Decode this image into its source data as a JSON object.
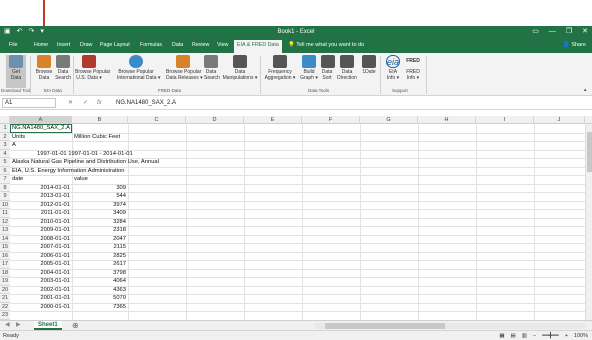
{
  "window": {
    "title": "Book1 - Excel",
    "icons": [
      "save-icon",
      "undo-icon",
      "redo-icon",
      "customize-icon"
    ],
    "controls": [
      "minimize-icon",
      "restore-icon",
      "close-icon"
    ],
    "control_glyphs": [
      "—",
      "❐",
      "✕"
    ]
  },
  "tabs": [
    {
      "label": "File"
    },
    {
      "label": "Home"
    },
    {
      "label": "Insert"
    },
    {
      "label": "Draw"
    },
    {
      "label": "Page Layout"
    },
    {
      "label": "Formulas"
    },
    {
      "label": "Data"
    },
    {
      "label": "Review"
    },
    {
      "label": "View"
    },
    {
      "label": "EIA & FRED Data"
    }
  ],
  "tellme": "Tell me what you want to do",
  "share": "Share",
  "ribbon": {
    "buttons": [
      {
        "label1": "Get",
        "label2": "Data",
        "icon": "download-icon",
        "color": "#6d8fb0"
      },
      {
        "label1": "Browse",
        "label2": "Data",
        "icon": "browse-icon",
        "color": "#d9822b"
      },
      {
        "label1": "Data",
        "label2": "Search",
        "icon": "search-icon",
        "color": "#7a7a7a"
      },
      {
        "label1": "Browse Popular",
        "label2": "U.S. Data ▾",
        "icon": "us-flag-icon",
        "color": "#b03a2e"
      },
      {
        "label1": "Browse Popular",
        "label2": "International Data ▾",
        "icon": "globe-icon",
        "color": "#3b8bc9"
      },
      {
        "label1": "Browse Popular",
        "label2": "Data Releases ▾",
        "icon": "calendar-icon",
        "color": "#d9822b"
      },
      {
        "label1": "Data",
        "label2": "Search",
        "icon": "search-icon",
        "color": "#7a7a7a"
      },
      {
        "label1": "Data",
        "label2": "Manipulations ▾",
        "icon": "calculator-icon",
        "color": "#555555"
      },
      {
        "label1": "Frequency",
        "label2": "Aggregation ▾",
        "icon": "sigma-icon",
        "color": "#555555"
      },
      {
        "label1": "Build",
        "label2": "Graph ▾",
        "icon": "graph-icon",
        "color": "#3b8bc9"
      },
      {
        "label1": "Data",
        "label2": "Sort",
        "icon": "sort-icon",
        "color": "#555555"
      },
      {
        "label1": "Data",
        "label2": "Direction",
        "icon": "direction-icon",
        "color": "#555555"
      },
      {
        "label1": "1Date",
        "label2": "",
        "icon": "date-icon",
        "color": "#555555"
      },
      {
        "label1": "EIA",
        "label2": "Info ▾",
        "icon": "eia-logo-icon",
        "color": "#1f5f9e"
      },
      {
        "label1": "FRED",
        "label2": "Info ▾",
        "icon": "fred-logo-icon",
        "color": "#333333"
      }
    ],
    "groups": [
      "Download Tool",
      "EIA Data",
      "FRED Data",
      "Data Tools",
      "Support"
    ],
    "eia_logo_text": "eia",
    "fred_logo_text": "FRED"
  },
  "formula_bar": {
    "namebox": "A1",
    "cancel": "✕",
    "enter": "✓",
    "fx": "fx",
    "value": "NG.NA1480_SAX_2.A"
  },
  "columns": [
    "A",
    "B",
    "C",
    "D",
    "E",
    "F",
    "G",
    "H",
    "I",
    "J"
  ],
  "rows": [
    "1",
    "2",
    "3",
    "4",
    "5",
    "6",
    "7",
    "8",
    "9",
    "10",
    "11",
    "12",
    "13",
    "14",
    "15",
    "16",
    "17",
    "18",
    "19",
    "20",
    "21",
    "22",
    "23"
  ],
  "cells": {
    "r1a": "NG.NA1480_SAX_2.A",
    "r2a": "Units",
    "r2b": "Million Cubic Feet",
    "r3a": "A",
    "r4": "1997-01-01  1997-01-01 - 2014-01-01",
    "r5": "Alaska Natural Gas Pipeline and Distribution Use, Annual",
    "r6": "EIA, U.S. Energy Information Administration",
    "r7a": "date",
    "r7b": "value"
  },
  "data_rows": [
    {
      "date": "2014-01-01",
      "value": "309"
    },
    {
      "date": "2013-01-01",
      "value": "544"
    },
    {
      "date": "2012-01-01",
      "value": "3974"
    },
    {
      "date": "2011-01-01",
      "value": "3409"
    },
    {
      "date": "2010-01-01",
      "value": "3284"
    },
    {
      "date": "2009-01-01",
      "value": "2318"
    },
    {
      "date": "2008-01-01",
      "value": "2047"
    },
    {
      "date": "2007-01-01",
      "value": "2115"
    },
    {
      "date": "2006-01-01",
      "value": "2825"
    },
    {
      "date": "2005-01-01",
      "value": "2617"
    },
    {
      "date": "2004-01-01",
      "value": "3798"
    },
    {
      "date": "2003-01-01",
      "value": "4064"
    },
    {
      "date": "2002-01-01",
      "value": "4363"
    },
    {
      "date": "2001-01-01",
      "value": "5070"
    },
    {
      "date": "2000-01-01",
      "value": "7365"
    }
  ],
  "sheets": {
    "active": "Sheet1",
    "add": "⊕",
    "prev": "◀",
    "next": "▶"
  },
  "status": {
    "left": "Ready",
    "zoom": "100%"
  },
  "colors": {
    "excel_green": "#217346",
    "annotation": "#c0392b"
  }
}
